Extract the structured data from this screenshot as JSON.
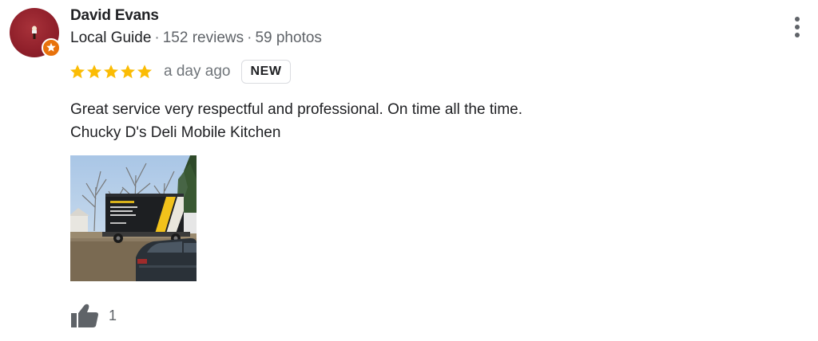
{
  "author": {
    "name": "David Evans",
    "role": "Local Guide",
    "reviews": "152 reviews",
    "photos": "59 photos",
    "separator": "·",
    "badge_icon": "local-guide-star-icon"
  },
  "rating": {
    "stars": 5,
    "max_stars": 5,
    "date": "a day ago",
    "badge": "NEW",
    "star_color": "#fbbc04"
  },
  "review": {
    "lines": [
      "Great service very respectful and professional. On time all the time.",
      "Chucky D's Deli Mobile Kitchen"
    ]
  },
  "photo": {
    "count": 1
  },
  "actions": {
    "like_icon": "thumbs-up-icon",
    "like_count": "1",
    "more_icon": "more-vert-icon"
  },
  "colors": {
    "text_primary": "#202124",
    "text_secondary": "#5f6368",
    "badge_orange": "#e8710a"
  }
}
